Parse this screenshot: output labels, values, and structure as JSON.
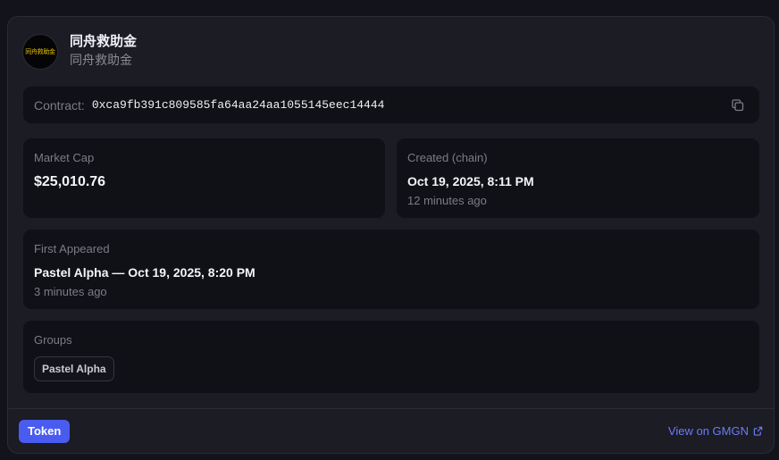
{
  "token": {
    "avatar_text": "同舟救助金",
    "name": "同舟救助金",
    "subtitle": "同舟救助金"
  },
  "contract": {
    "label": "Contract:",
    "address": "0xca9fb391c809585fa64aa24aa1055145eec14444"
  },
  "market_cap": {
    "label": "Market Cap",
    "value": "$25,010.76"
  },
  "created": {
    "label": "Created (chain)",
    "value": "Oct 19, 2025, 8:11 PM",
    "relative": "12 minutes ago"
  },
  "first_appeared": {
    "label": "First Appeared",
    "value": "Pastel Alpha — Oct 19, 2025, 8:20 PM",
    "relative": "3 minutes ago"
  },
  "groups": {
    "label": "Groups",
    "items": [
      "Pastel Alpha"
    ]
  },
  "footer": {
    "badge": "Token",
    "link": "View on GMGN"
  },
  "icons": {
    "copy": "copy-icon",
    "external": "external-link-icon"
  },
  "colors": {
    "accent": "#4a5cf0",
    "link": "#6d7cf5",
    "background": "#13141b",
    "card": "#1b1c24",
    "panel": "#101117"
  }
}
